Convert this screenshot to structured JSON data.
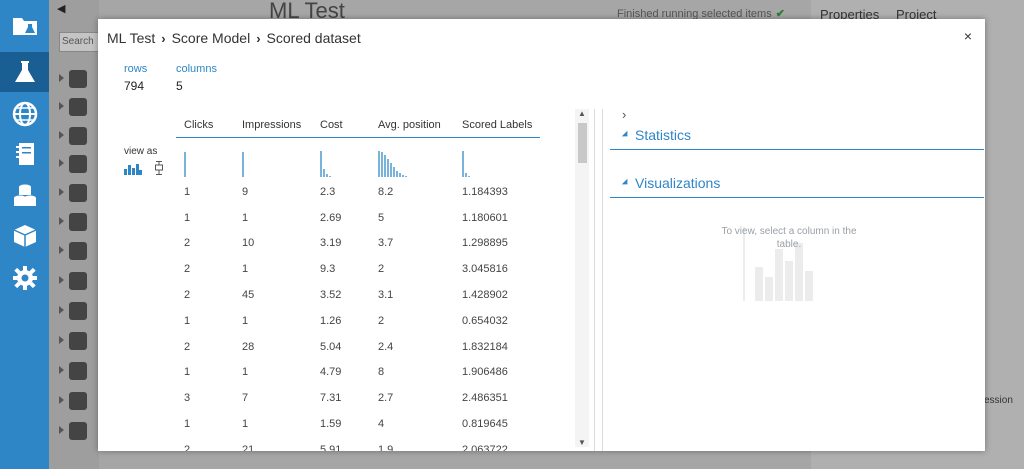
{
  "workspace": {
    "title": "ML Test",
    "status": "Finished running selected items",
    "right_tabs": [
      "Properties",
      "Project"
    ],
    "session_fragment": "ession"
  },
  "palette": {
    "search_placeholder": "Search"
  },
  "rail_icons": [
    "projects-icon",
    "experiments-icon",
    "web-services-icon",
    "notebooks-icon",
    "datasets-icon",
    "trained-models-icon",
    "settings-icon"
  ],
  "modal": {
    "breadcrumb": [
      "ML Test",
      "Score Model",
      "Scored dataset"
    ],
    "close_label": "×",
    "rows_label": "rows",
    "rows_value": "794",
    "columns_label": "columns",
    "columns_value": "5",
    "view_as_label": "view as",
    "table": {
      "headers": [
        "Clicks",
        "Impressions",
        "Cost",
        "Avg. position",
        "Scored Labels"
      ],
      "rows": [
        [
          "1",
          "9",
          "2.3",
          "8.2",
          "1.184393"
        ],
        [
          "1",
          "1",
          "2.69",
          "5",
          "1.180601"
        ],
        [
          "2",
          "10",
          "3.19",
          "3.7",
          "1.298895"
        ],
        [
          "2",
          "1",
          "9.3",
          "2",
          "3.045816"
        ],
        [
          "2",
          "45",
          "3.52",
          "3.1",
          "1.428902"
        ],
        [
          "1",
          "1",
          "1.26",
          "2",
          "0.654032"
        ],
        [
          "2",
          "28",
          "5.04",
          "2.4",
          "1.832184"
        ],
        [
          "1",
          "1",
          "4.79",
          "8",
          "1.906486"
        ],
        [
          "3",
          "7",
          "7.31",
          "2.7",
          "2.486351"
        ],
        [
          "1",
          "1",
          "1.59",
          "4",
          "0.819645"
        ],
        [
          "2",
          "21",
          "5.91",
          "1.9",
          "2.063722"
        ]
      ]
    },
    "right_panel": {
      "statistics_label": "Statistics",
      "visualizations_label": "Visualizations",
      "empty_message": "To view, select a column in the table."
    }
  },
  "colors": {
    "accent": "#2f86c6",
    "bar": "#7ab3d9"
  }
}
